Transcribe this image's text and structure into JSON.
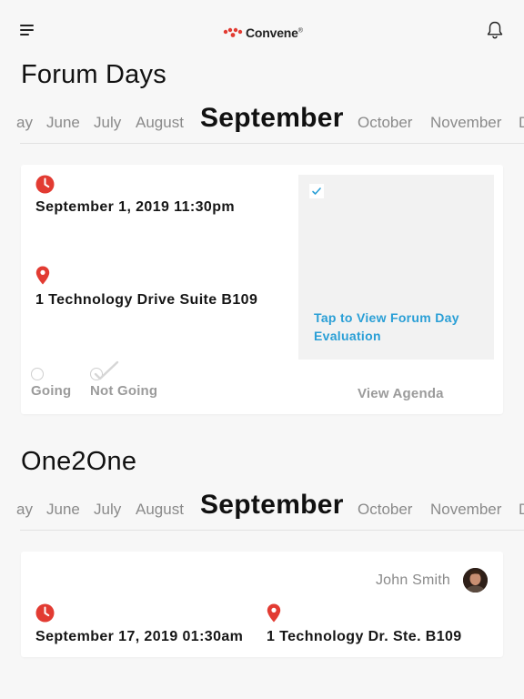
{
  "header": {
    "brand": "Convene",
    "brand_mark": "®",
    "brand_color": "#e23b32",
    "menu_icon": "hamburger-icon",
    "notification_icon": "bell-icon"
  },
  "forum_days": {
    "title": "Forum Days",
    "months": {
      "prev_partial": "ay",
      "m1": "June",
      "m2": "July",
      "m3": "August",
      "active": "September",
      "m5": "October",
      "m6": "November",
      "next_partial": "D"
    },
    "event": {
      "datetime": "September 1, 2019 11:30pm",
      "location": "1 Technology Drive Suite B109",
      "evaluation_link": "Tap to View Forum Day Evaluation",
      "rsvp_going": "Going",
      "rsvp_not_going": "Not Going",
      "view_agenda": "View Agenda",
      "accent_color": "#e23b32",
      "link_color": "#2a9fd6"
    }
  },
  "one2one": {
    "title": "One2One",
    "months": {
      "prev_partial": "ay",
      "m1": "June",
      "m2": "July",
      "m3": "August",
      "active": "September",
      "m5": "October",
      "m6": "November",
      "next_partial": "D"
    },
    "meeting": {
      "person": "John Smith",
      "datetime": "September 17, 2019 01:30am",
      "location": "1 Technology Dr. Ste. B109"
    }
  }
}
